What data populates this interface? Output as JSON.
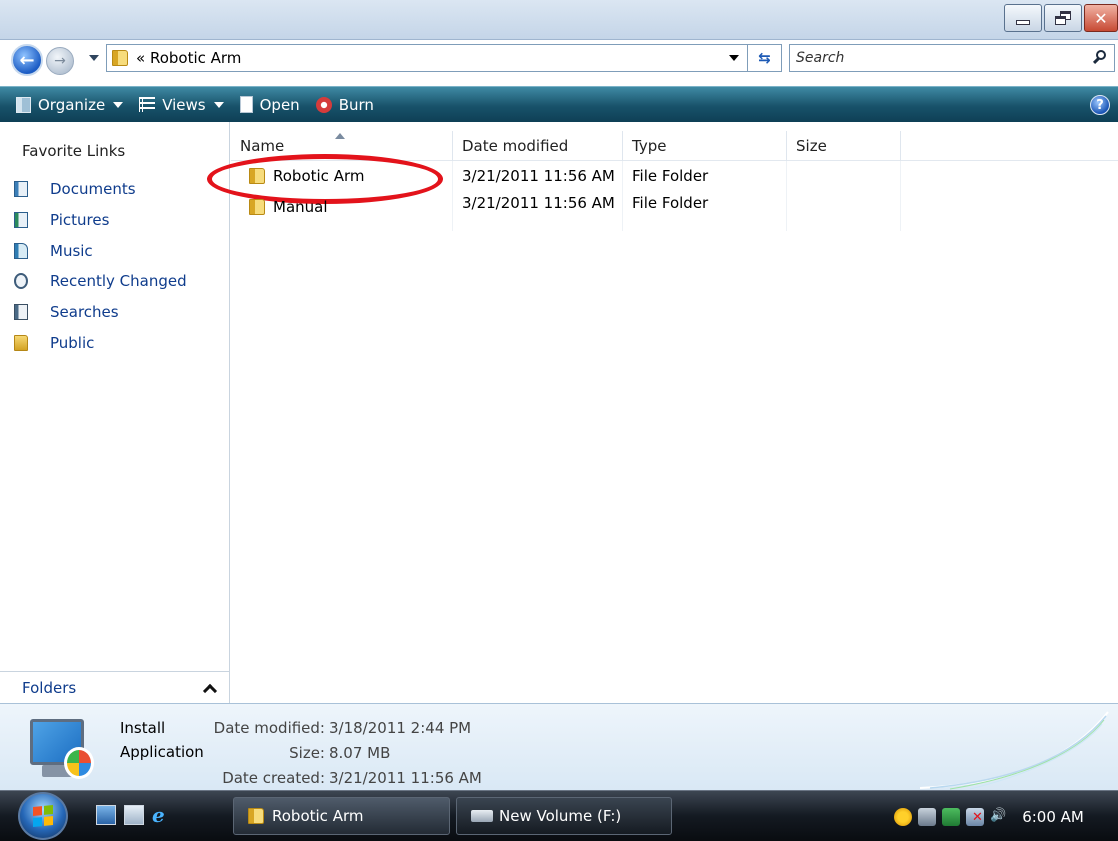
{
  "window": {
    "address_path": "« Robotic Arm",
    "search_placeholder": "Search",
    "minimize_label": "Minimize",
    "maximize_label": "Maximize",
    "close_label": "Close"
  },
  "toolbar": {
    "organize": "Organize",
    "views": "Views",
    "open": "Open",
    "burn": "Burn",
    "help": "?"
  },
  "navigation": {
    "favorites_header": "Favorite Links",
    "items": [
      {
        "label": "Documents",
        "icon": "documents-icon"
      },
      {
        "label": "Pictures",
        "icon": "pictures-icon"
      },
      {
        "label": "Music",
        "icon": "music-icon"
      },
      {
        "label": "Recently Changed",
        "icon": "recently-changed-icon"
      },
      {
        "label": "Searches",
        "icon": "searches-icon"
      },
      {
        "label": "Public",
        "icon": "public-folder-icon"
      }
    ],
    "folders_label": "Folders"
  },
  "columns": {
    "name": "Name",
    "date_modified": "Date modified",
    "type": "Type",
    "size": "Size"
  },
  "files": [
    {
      "name": "Robotic Arm",
      "date_modified": "3/21/2011 11:56 AM",
      "type": "File Folder",
      "size": ""
    },
    {
      "name": "Manual",
      "date_modified": "3/21/2011 11:56 AM",
      "type": "File Folder",
      "size": ""
    }
  ],
  "details": {
    "name_line1": "Install",
    "name_line2": "Application",
    "date_modified_label": "Date modified:",
    "date_modified": "3/18/2011 2:44 PM",
    "size_label": "Size:",
    "size": "8.07 MB",
    "date_created_label": "Date created:",
    "date_created": "3/21/2011 11:56 AM"
  },
  "taskbar": {
    "active_window": "Robotic Arm",
    "second_window": "New Volume (F:)",
    "clock": "6:00 AM"
  },
  "colors": {
    "highlight_ring": "#e3131b",
    "link_text": "#0f3c8c",
    "command_bar": "#18526a"
  }
}
